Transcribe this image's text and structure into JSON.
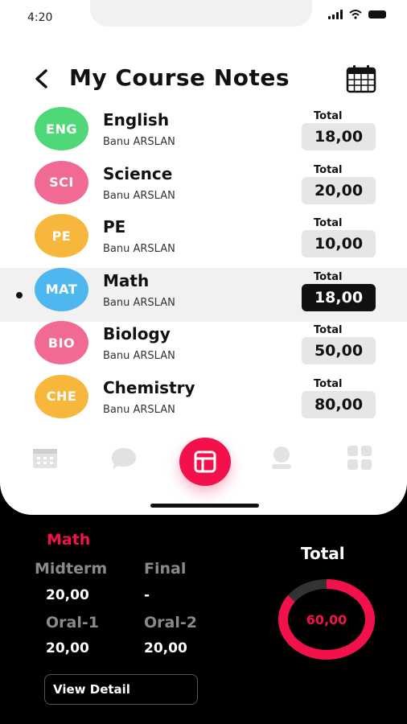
{
  "status_bar": {
    "time": "4:20"
  },
  "header": {
    "title": "My Course Notes"
  },
  "courses": [
    {
      "abbr": "ENG",
      "name": "English",
      "teacher": "Banu ARSLAN",
      "total_label": "Total",
      "total": "18,00",
      "color": "#4fd877"
    },
    {
      "abbr": "SCI",
      "name": "Science",
      "teacher": "Banu ARSLAN",
      "total_label": "Total",
      "total": "20,00",
      "color": "#f06a93"
    },
    {
      "abbr": "PE",
      "name": "PE",
      "teacher": "Banu ARSLAN",
      "total_label": "Total",
      "total": "10,00",
      "color": "#f7b73c"
    },
    {
      "abbr": "MAT",
      "name": "Math",
      "teacher": "Banu ARSLAN",
      "total_label": "Total",
      "total": "18,00",
      "color": "#4fb7f0",
      "selected": true
    },
    {
      "abbr": "BIO",
      "name": "Biology",
      "teacher": "Banu ARSLAN",
      "total_label": "Total",
      "total": "50,00",
      "color": "#f06a93"
    },
    {
      "abbr": "CHE",
      "name": "Chemistry",
      "teacher": "Banu ARSLAN",
      "total_label": "Total",
      "total": "80,00",
      "color": "#f7b73c"
    }
  ],
  "tabs": [
    {
      "icon": "calendar-icon"
    },
    {
      "icon": "chat-icon"
    },
    {
      "icon": "notes-icon",
      "active": true
    },
    {
      "icon": "user-icon"
    },
    {
      "icon": "grid-icon"
    }
  ],
  "detail": {
    "subject": "Math",
    "midterm_label": "Midterm",
    "midterm_value": "20,00",
    "final_label": "Final",
    "final_value": "-",
    "oral1_label": "Oral-1",
    "oral1_value": "20,00",
    "oral2_label": "Oral-2",
    "oral2_value": "20,00",
    "total_label": "Total",
    "total_value": "60,00",
    "total_fraction": 0.85,
    "view_detail": "View Detail"
  },
  "colors": {
    "accent": "#f3114c",
    "track": "#333333"
  }
}
